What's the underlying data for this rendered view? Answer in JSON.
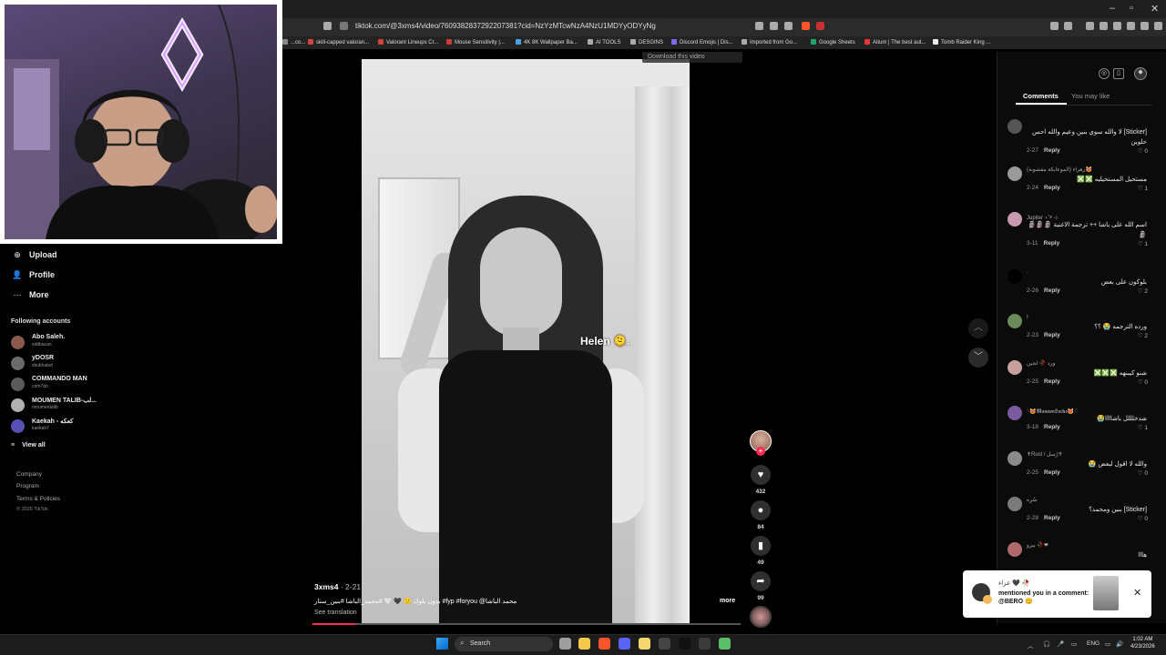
{
  "browser": {
    "url": "tiktok.com/@3xms4/video/7609382837292207381?cid=NzYzMTcwNzA4NzU1MDYyODYyNg",
    "bookmarks": [
      {
        "label": "...co...",
        "color": "#888888"
      },
      {
        "label": "skill-capped valoran...",
        "color": "#d0453a"
      },
      {
        "label": "Valorant Lineups Cr...",
        "color": "#d0453a"
      },
      {
        "label": "Mouse Sensitivity |...",
        "color": "#c83c3c"
      },
      {
        "label": "4K 8K Wallpaper Ba...",
        "color": "#4aa3df"
      },
      {
        "label": "AI TOOLS",
        "color": "#aaaaaa"
      },
      {
        "label": "DESGINS",
        "color": "#aaaaaa"
      },
      {
        "label": "Discord Emojis | Dis...",
        "color": "#7b6cf6"
      },
      {
        "label": "Imported from Go...",
        "color": "#aaaaaa"
      },
      {
        "label": "Google Sheets",
        "color": "#21a366"
      },
      {
        "label": "Aitum | The best aut...",
        "color": "#e53935"
      },
      {
        "label": "Tomb Raider King ...",
        "color": "#eeeeee"
      }
    ],
    "download_pill": "Download this video"
  },
  "sidebar": {
    "items": [
      {
        "label": "Upload",
        "icon": "plus-square-icon",
        "glyph": "⊕"
      },
      {
        "label": "Profile",
        "icon": "person-icon",
        "glyph": "👤"
      },
      {
        "label": "More",
        "icon": "more-icon",
        "glyph": "⋯"
      }
    ],
    "following_heading": "Following accounts",
    "accounts": [
      {
        "name": "Abo Saleh.",
        "handle": "editbacan",
        "color": "#8a5a4a"
      },
      {
        "name": "yDOSR",
        "handle": "xbukhaled",
        "color": "#6a6a6a"
      },
      {
        "name": "COMMANDO MAN",
        "handle": "com7do",
        "color": "#5a5a5a"
      },
      {
        "name": "MOUMEN TALIB-لب...",
        "handle": "moumentalib",
        "color": "#b0b0b0"
      },
      {
        "name": "Kaekah - كعكه",
        "handle": "kaekah7",
        "color": "#5a4fb5"
      }
    ],
    "view_all": "View all",
    "footer": [
      "Company",
      "Program",
      "Terms & Policies"
    ],
    "copyright": "© 2026 TikTok"
  },
  "video": {
    "overlay_text": "Helen 🫠.",
    "author": "3xms4",
    "date": "· 2-21",
    "caption": "بدون بلوك 🙂 🖤 🤍 #محمد_الباشا #بنين_ستار #fyp #foryou @محمد الباشا",
    "more": "more",
    "see_translation": "See translation",
    "progress": 0.1
  },
  "actions": {
    "likes": "432",
    "comments": "84",
    "saves": "49",
    "shares": "99"
  },
  "panel": {
    "tabs": [
      "Comments",
      "You may like"
    ],
    "comments": [
      {
        "user": "",
        "text": "[Sticker] لا والله سوي بنين وعيم والله احس حلوين",
        "date": "2-27",
        "likes": "0",
        "color": "#555555"
      },
      {
        "user": "زهراء (الموعابكة مقشوبة)😻",
        "text": "مستحيل المستحيليه ❎❎",
        "date": "2-24",
        "likes": "1",
        "color": "#9a9a9a"
      },
      {
        "user": "Jupiter ⋆˚࿔ ⊹",
        "text": "اسم الله على باشا ++ ترجمة الاغنية 🗿🗿🗿🗿",
        "date": "3-11",
        "likes": "1",
        "color": "#c79ab0"
      },
      {
        "user": ".",
        "text": "بلوكون على بعض",
        "date": "2-26",
        "likes": "2",
        "color": "#000000"
      },
      {
        "user": "ا",
        "text": "ورده الترجمه 😭 ؟؟",
        "date": "2-23",
        "likes": "2",
        "color": "#6a8a5a"
      },
      {
        "user": "ورد 🥀 لجين",
        "text": "شنو كيبنهه ❎❎❎",
        "date": "2-25",
        "likes": "0",
        "color": "#c9a0a0"
      },
      {
        "user": "𓆩😻𝕸𝖆𝖓𝖔𝖔𝖓𝕷𝖆𝖈𝖐𝖊😻𓆪",
        "text": "شدخلللل باشاااا😭",
        "date": "3-18",
        "likes": "1",
        "color": "#7a5aa0"
      },
      {
        "user": "✝Rusl / رُسل✝",
        "text": "والله لا اقول لبعض 😭",
        "date": "2-25",
        "likes": "0",
        "color": "#8a8a8a"
      },
      {
        "user": "سُرِه",
        "text": "[Sticker] بنين ومحمد؟",
        "date": "2-28",
        "likes": "0",
        "color": "#7a7a7a"
      },
      {
        "user": "بيرو 🥀❤",
        "text": "هااا",
        "date": "",
        "likes": "",
        "color": "#b06a6a"
      }
    ],
    "reply_label": "Reply"
  },
  "notification": {
    "user": "عزاء 🖤 🥀",
    "text": "mentioned you in a comment: @BERO 😊",
    "close": "✕"
  },
  "taskbar": {
    "search": "Search",
    "apps": [
      {
        "name": "file-icon",
        "color": "#9e9e9e"
      },
      {
        "name": "explorer-icon",
        "color": "#f2c94c"
      },
      {
        "name": "brave-icon",
        "color": "#fb542b"
      },
      {
        "name": "discord-icon",
        "color": "#5865f2"
      },
      {
        "name": "notes-icon",
        "color": "#f5d76e"
      },
      {
        "name": "terminal-icon",
        "color": "#444444"
      },
      {
        "name": "tiktok-icon",
        "color": "#111111"
      },
      {
        "name": "obs-icon",
        "color": "#3a3a3a"
      },
      {
        "name": "app-icon",
        "color": "#5bbf6a"
      }
    ],
    "lang": "ENG",
    "time": "1:02 AM",
    "date": "4/23/2026"
  }
}
